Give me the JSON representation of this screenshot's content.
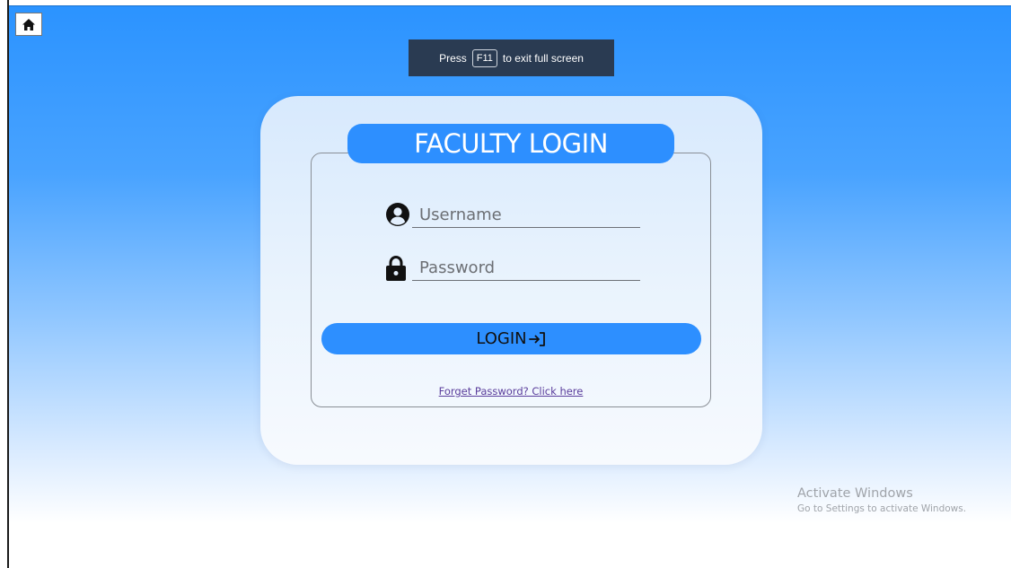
{
  "toolbar": {
    "home_icon": "home-icon"
  },
  "fullscreen_notice": {
    "prefix": "Press",
    "key": "F11",
    "suffix": "to exit full screen"
  },
  "login": {
    "title": "FACULTY LOGIN",
    "username_placeholder": "Username",
    "username_value": "",
    "username_icon": "user-circle-icon",
    "password_placeholder": "Password",
    "password_value": "",
    "password_icon": "lock-icon",
    "login_label": "LOGIN",
    "login_icon": "sign-in-icon",
    "forgot_link": "Forget Password? Click here"
  },
  "watermark": {
    "title": "Activate Windows",
    "subtitle": "Go to Settings to activate Windows."
  },
  "colors": {
    "accent": "#2d8fff",
    "background_top": "#2b93ff",
    "toast": "#2a3b52",
    "link": "#5a3d9c"
  }
}
